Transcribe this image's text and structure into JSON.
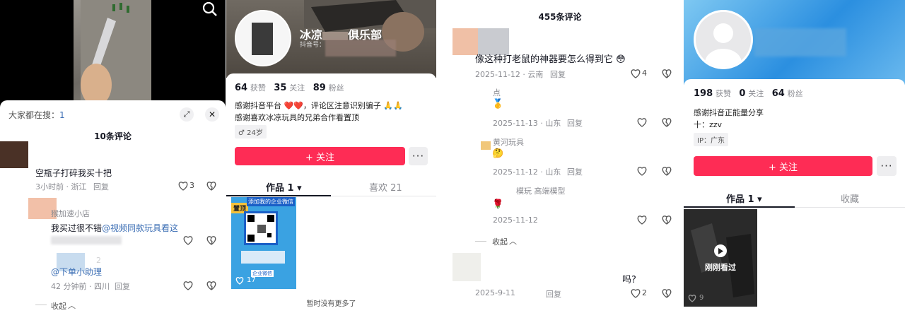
{
  "p1": {
    "search_prefix": "大家都在搜：",
    "search_suffix": "1",
    "comment_count": "10条评论",
    "c1_text": "空瓶子打碎我买十把",
    "c1_meta": "3小时前 · 浙江",
    "c1_likes": "3",
    "reply": "回复",
    "c2_name": "猴加速小店",
    "c2_text": "我买过很不错",
    "c2_mention": "@视频同款玩具看这",
    "c3_meta_time": "2",
    "c3_mention": "@下单小助理",
    "c3_meta": "42 分钟前 · 四川",
    "collapse": "收起"
  },
  "p2": {
    "name": "冰凉",
    "name2": "俱乐部",
    "id_label": "抖音号：",
    "likes_num": "64",
    "likes_label": "获赞",
    "following_num": "35",
    "following_label": "关注",
    "followers_num": "89",
    "followers_label": "粉丝",
    "bio1": "感谢抖音平台",
    "bio1b": "，评论区注意识别骗子",
    "bio2": "感谢喜欢冰凉玩具的兄弟合作看置顶",
    "gender_age": "♂ 24岁",
    "follow": "+ 关注",
    "more": "···",
    "tab_works": "作品 1 ▾",
    "tab_likes": "喜欢 21",
    "pin": "置顶",
    "thumb_title": "添加我的企业微信",
    "thumb_brand": "企业微信",
    "thumb_likes": "17",
    "no_more": "暂时没有更多了"
  },
  "p3": {
    "comment_count": "455条评论",
    "c1_text": "像这种打老鼠的神器要怎么得到它",
    "c1_meta": "2025-11-12 · 云南",
    "c1_likes": "4",
    "reply": "回复",
    "r1_name": "点",
    "r1_meta": "2025-11-13 · 山东",
    "r2_name": "黄河玩具",
    "r2_meta": "2025-11-12 · 山东",
    "r3_text": "模玩  高端模型",
    "r3_meta": "2025-11-12",
    "collapse": "收起",
    "c2_suffix": "吗?",
    "c2_meta": "2025-9-11",
    "c2_likes": "2"
  },
  "p4": {
    "likes_num": "198",
    "likes_label": "获赞",
    "following_num": "0",
    "following_label": "关注",
    "followers_num": "64",
    "followers_label": "粉丝",
    "bio1": "感谢抖音正能量分享",
    "bio2": "十：zzv",
    "ip": "IP：广东",
    "follow": "+ 关注",
    "more": "···",
    "tab_works": "作品 1 ▾",
    "tab_fav": "收藏",
    "recent": "刚刚看过",
    "thumb_likes": "9"
  }
}
